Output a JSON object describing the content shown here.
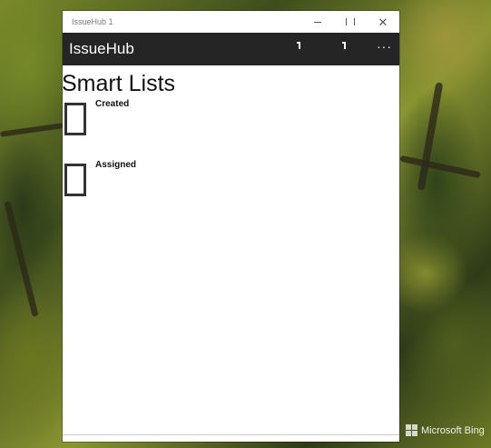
{
  "window": {
    "title": "IssueHub 1"
  },
  "appbar": {
    "title": "IssueHub",
    "more_label": "···"
  },
  "page": {
    "heading": "Smart Lists"
  },
  "smart_lists": [
    {
      "label": "Created"
    },
    {
      "label": "Assigned"
    }
  ],
  "desktop": {
    "watermark": "Microsoft Bing"
  },
  "colors": {
    "appbar_bg": "#252526",
    "window_bg": "#ffffff"
  }
}
